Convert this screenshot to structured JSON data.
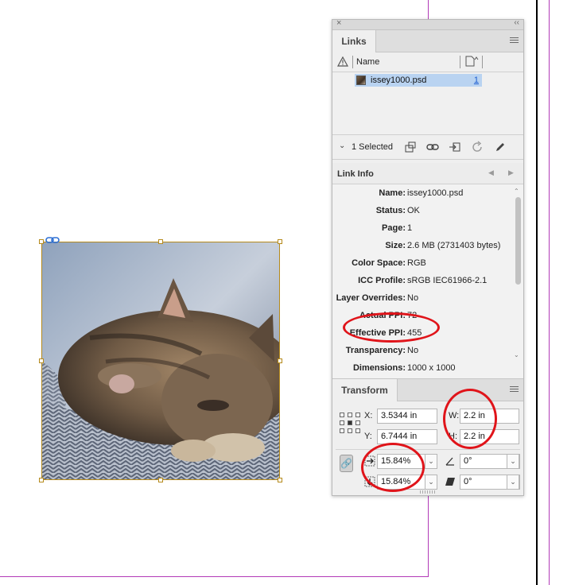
{
  "links_panel": {
    "close_glyph": "×",
    "collapse_glyph": "‹‹",
    "tab_label": "Links",
    "column_name": "Name",
    "links": [
      {
        "name": "issey1000.psd",
        "page": "1"
      }
    ],
    "selected_text": "1 Selected"
  },
  "link_info": {
    "header": "Link Info",
    "rows": [
      {
        "label": "Name:",
        "value": "issey1000.psd"
      },
      {
        "label": "Status:",
        "value": "OK"
      },
      {
        "label": "Page:",
        "value": "1"
      },
      {
        "label": "Size:",
        "value": "2.6 MB (2731403 bytes)"
      },
      {
        "label": "Color Space:",
        "value": "RGB"
      },
      {
        "label": "ICC Profile:",
        "value": "sRGB IEC61966-2.1"
      },
      {
        "label": "Layer Overrides:",
        "value": "No"
      },
      {
        "label": "Actual PPI:",
        "value": "72"
      },
      {
        "label": "Effective PPI:",
        "value": "455"
      },
      {
        "label": "Transparency:",
        "value": "No"
      },
      {
        "label": "Dimensions:",
        "value": "1000 x 1000"
      }
    ]
  },
  "transform": {
    "tab_label": "Transform",
    "x_label": "X:",
    "x_value": "3.5344 in",
    "y_label": "Y:",
    "y_value": "6.7444 in",
    "w_label": "W:",
    "w_value": "2.2 in",
    "h_label": "H:",
    "h_value": "2.2 in",
    "scale_x": "15.84%",
    "scale_y": "15.84%",
    "rotation": "0°",
    "shear": "0°"
  },
  "colors": {
    "guide": "#b23ab8",
    "frame": "#b58a1c",
    "selection": "#b9d3f1",
    "annotation": "#e0141a",
    "link_page": "#1a5bd0"
  }
}
